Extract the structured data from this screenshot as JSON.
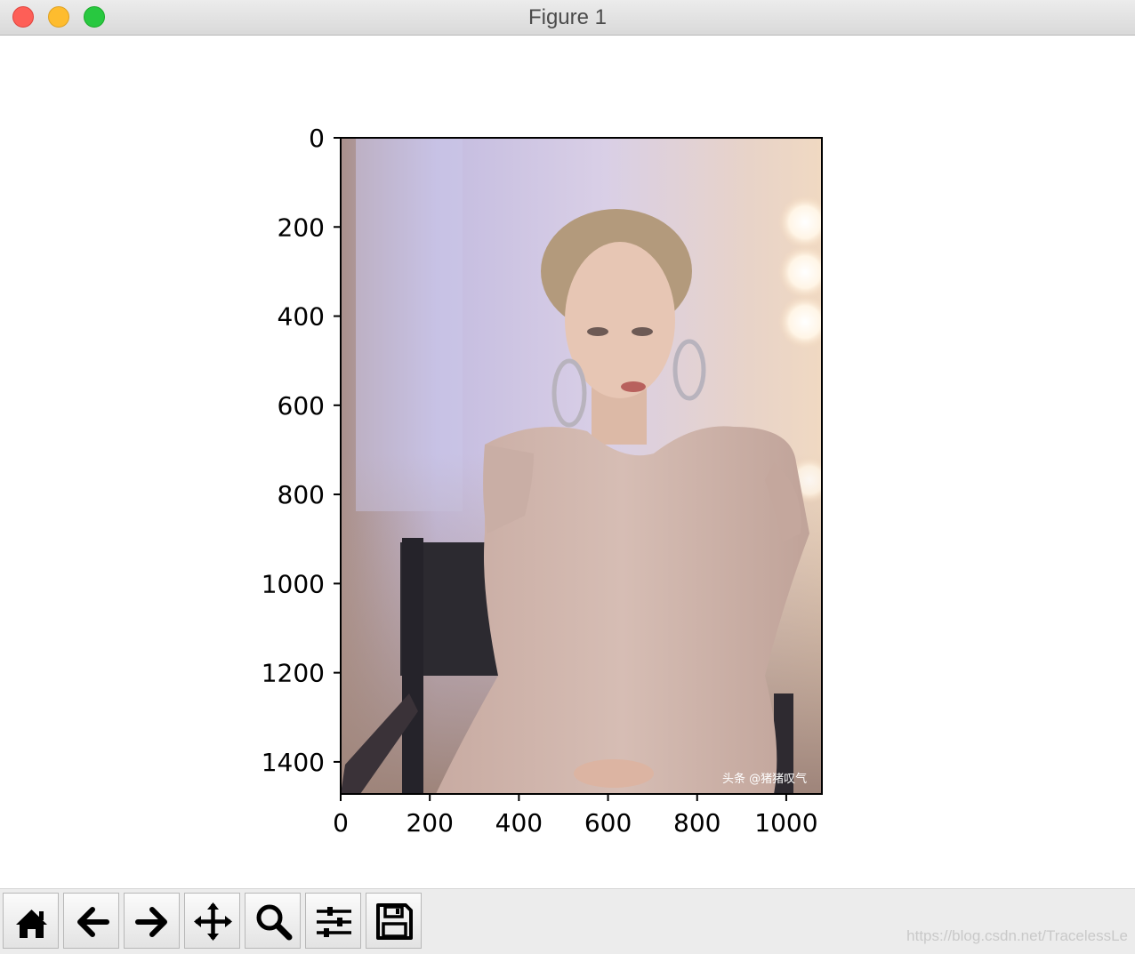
{
  "window": {
    "title": "Figure 1",
    "buttons": [
      "close",
      "minimize",
      "maximize"
    ]
  },
  "chart_data": {
    "type": "image",
    "xlim": [
      0,
      1080
    ],
    "ylim": [
      1472,
      0
    ],
    "x_ticks": [
      0,
      200,
      400,
      600,
      800,
      1000
    ],
    "y_ticks": [
      0,
      200,
      400,
      600,
      800,
      1000,
      1200,
      1400
    ],
    "image_caption_text": "头条 @猪猪叹气"
  },
  "toolbar": {
    "buttons": [
      {
        "icon": "home-icon"
      },
      {
        "icon": "back-arrow-icon"
      },
      {
        "icon": "forward-arrow-icon"
      },
      {
        "icon": "pan-icon"
      },
      {
        "icon": "zoom-icon"
      },
      {
        "icon": "configure-subplots-icon"
      },
      {
        "icon": "save-icon"
      }
    ]
  },
  "watermark": "https://blog.csdn.net/TracelessLe"
}
